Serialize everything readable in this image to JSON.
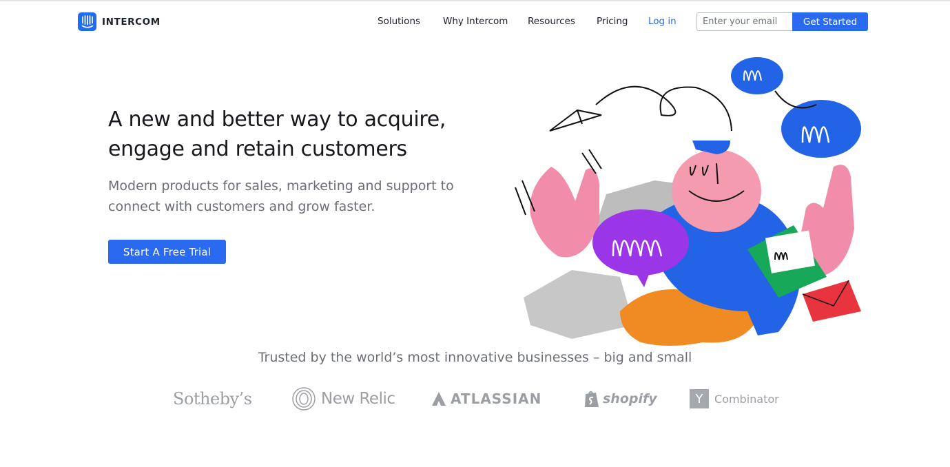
{
  "nav": {
    "brand": "INTERCOM",
    "links": [
      "Solutions",
      "Why Intercom",
      "Resources",
      "Pricing"
    ],
    "login": "Log in",
    "email_placeholder": "Enter your email",
    "cta": "Get Started"
  },
  "hero": {
    "title_lines": [
      "A new and better way to acquire,",
      "engage and retain customers"
    ],
    "subtitle_lines": [
      "Modern products for sales, marketing and support to",
      "connect with customers and grow faster."
    ],
    "cta": "Start A Free Trial"
  },
  "trusted": {
    "heading": "Trusted by the world’s most innovative businesses – big and small",
    "logos": [
      "Sotheby’s",
      "New Relic",
      "ATLASSIAN",
      "shopify",
      "Y",
      "Combinator"
    ]
  },
  "colors": {
    "accent": "#2a6af0",
    "text": "#16181d",
    "muted": "#6b6e76",
    "logo_gray": "#9b9ea3"
  },
  "icons": [
    "intercom-logo-icon",
    "chat-bubble-icon",
    "paper-plane-icon",
    "envelope-icon",
    "new-relic-icon",
    "atlassian-icon",
    "shopify-bag-icon"
  ]
}
